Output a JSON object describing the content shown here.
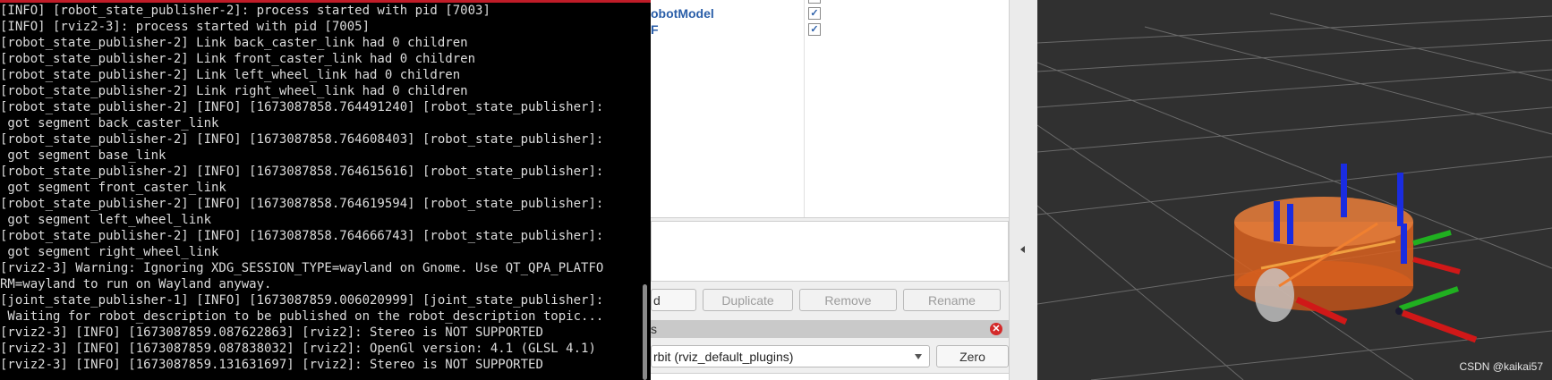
{
  "terminal": {
    "lines": [
      "[INFO] [robot_state_publisher-2]: process started with pid [7003]",
      "[INFO] [rviz2-3]: process started with pid [7005]",
      "[robot_state_publisher-2] Link back_caster_link had 0 children",
      "[robot_state_publisher-2] Link front_caster_link had 0 children",
      "[robot_state_publisher-2] Link left_wheel_link had 0 children",
      "[robot_state_publisher-2] Link right_wheel_link had 0 children",
      "[robot_state_publisher-2] [INFO] [1673087858.764491240] [robot_state_publisher]:",
      " got segment back_caster_link",
      "[robot_state_publisher-2] [INFO] [1673087858.764608403] [robot_state_publisher]:",
      " got segment base_link",
      "[robot_state_publisher-2] [INFO] [1673087858.764615616] [robot_state_publisher]:",
      " got segment front_caster_link",
      "[robot_state_publisher-2] [INFO] [1673087858.764619594] [robot_state_publisher]:",
      " got segment left_wheel_link",
      "[robot_state_publisher-2] [INFO] [1673087858.764666743] [robot_state_publisher]:",
      " got segment right_wheel_link",
      "[rviz2-3] Warning: Ignoring XDG_SESSION_TYPE=wayland on Gnome. Use QT_QPA_PLATFO",
      "RM=wayland to run on Wayland anyway.",
      "[joint_state_publisher-1] [INFO] [1673087859.006020999] [joint_state_publisher]:",
      " Waiting for robot_description to be published on the robot_description topic...",
      "[rviz2-3] [INFO] [1673087859.087622863] [rviz2]: Stereo is NOT SUPPORTED",
      "[rviz2-3] [INFO] [1673087859.087838032] [rviz2]: OpenGl version: 4.1 (GLSL 4.1)",
      "[rviz2-3] [INFO] [1673087859.131631697] [rviz2]: Stereo is NOT SUPPORTED"
    ]
  },
  "displays": {
    "items": [
      {
        "label": "obotModel",
        "checked": "✓"
      },
      {
        "label": "F",
        "checked": "✓"
      }
    ]
  },
  "buttons": {
    "add": "d",
    "duplicate": "Duplicate",
    "remove": "Remove",
    "rename": "Rename"
  },
  "views": {
    "title": "s",
    "close": "✕",
    "type_value": "rbit (rviz_default_plugins)",
    "zero": "Zero"
  },
  "properties_partial": {
    "left": "",
    "right": ""
  },
  "watermark": "CSDN @kaikai57",
  "colors": {
    "terminal_bg": "#000000",
    "terminal_text": "#dcdcdc",
    "accent_bar": "#c01c28",
    "viewport_bg": "#303030",
    "grid": "#6a6a6a",
    "link_blue": "#2a5ea8",
    "robot_body": "#d9601e"
  },
  "icons": {
    "checkbox": "check-icon",
    "close": "close-icon",
    "dropdown": "chevron-down-icon",
    "collapse": "chevron-left-icon"
  }
}
